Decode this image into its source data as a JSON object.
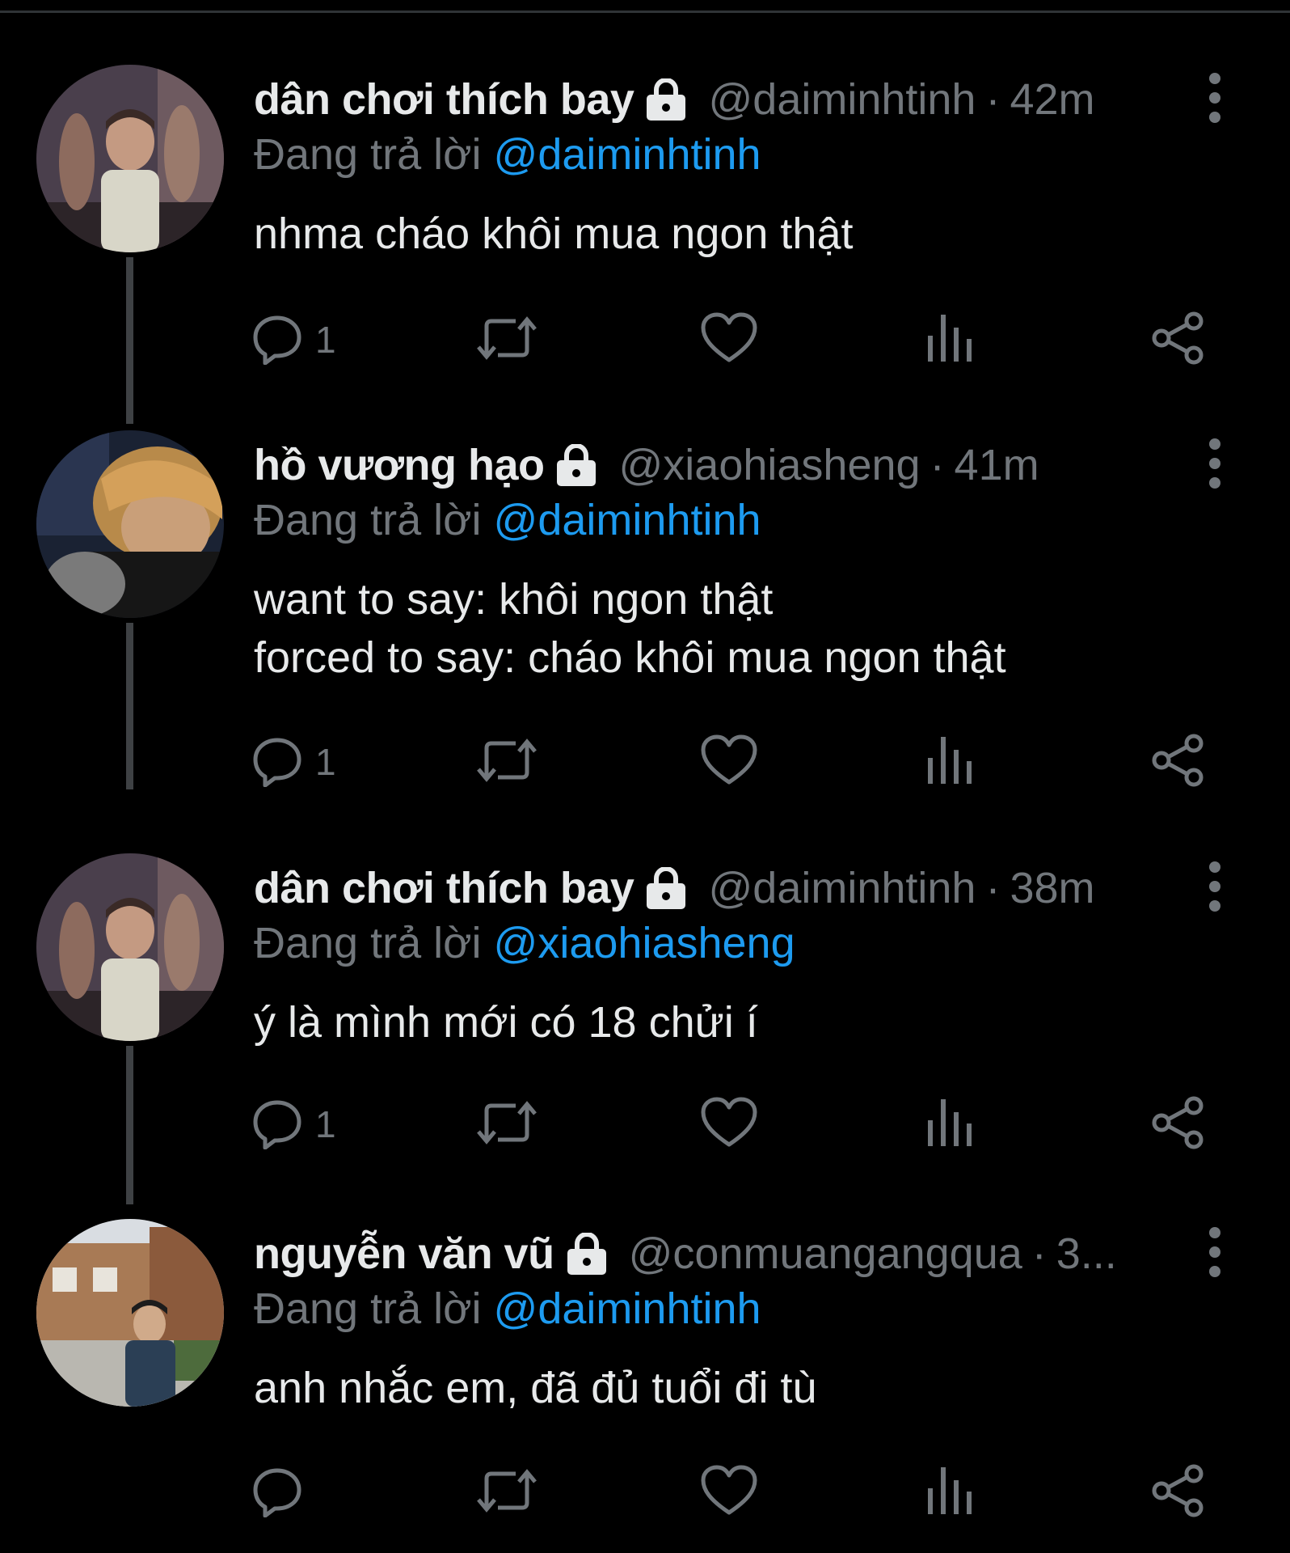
{
  "tweets": [
    {
      "name": "dân chơi thích bay",
      "handle": "@daiminhtinh",
      "time": "42m",
      "replying_prefix": "Đang trả lời",
      "replying_to": "@daiminhtinh",
      "text": "nhma cháo khôi mua ngon thật",
      "reply_count": "1",
      "avatar": "avatar-person-tattoo",
      "locked": true
    },
    {
      "name": "hồ vương hạo",
      "handle": "@xiaohiasheng",
      "time": "41m",
      "replying_prefix": "Đang trả lời",
      "replying_to": "@daiminhtinh",
      "text_line1": "want to say: khôi ngon thật",
      "text_line2": "forced to say: cháo khôi mua ngon thật",
      "reply_count": "1",
      "avatar": "avatar-blond-hair",
      "locked": true
    },
    {
      "name": "dân chơi thích bay",
      "handle": "@daiminhtinh",
      "time": "38m",
      "replying_prefix": "Đang trả lời",
      "replying_to": "@xiaohiasheng",
      "text": "ý là mình mới có 18 chửi í",
      "reply_count": "1",
      "avatar": "avatar-person-tattoo",
      "locked": true
    },
    {
      "name": "nguyễn văn vũ",
      "handle": "@conmuangangqua",
      "time": "3...",
      "replying_prefix": "Đang trả lời",
      "replying_to": "@daiminhtinh",
      "text": "anh nhắc em, đã đủ tuổi đi tù",
      "reply_count": "",
      "avatar": "avatar-street-photo",
      "locked": true
    }
  ],
  "colors": {
    "background": "#000000",
    "primary_text": "#e7e9ea",
    "secondary_text": "#71767b",
    "mention": "#1d9bf0",
    "thread_line": "#3e4144"
  },
  "icons": [
    "lock-icon",
    "more-icon",
    "reply-icon",
    "retweet-icon",
    "like-icon",
    "views-icon",
    "share-icon"
  ]
}
